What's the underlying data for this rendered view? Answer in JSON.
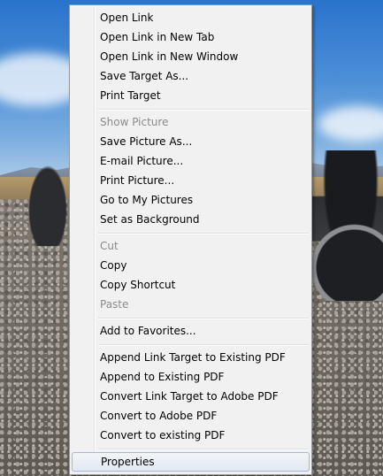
{
  "context_menu": {
    "groups": [
      {
        "items": [
          {
            "label": "Open Link"
          },
          {
            "label": "Open Link in New Tab"
          },
          {
            "label": "Open Link in New Window"
          },
          {
            "label": "Save Target As..."
          },
          {
            "label": "Print Target"
          }
        ]
      },
      {
        "items": [
          {
            "label": "Show Picture",
            "disabled": true
          },
          {
            "label": "Save Picture As..."
          },
          {
            "label": "E-mail Picture..."
          },
          {
            "label": "Print Picture..."
          },
          {
            "label": "Go to My Pictures"
          },
          {
            "label": "Set as Background"
          }
        ]
      },
      {
        "items": [
          {
            "label": "Cut",
            "disabled": true
          },
          {
            "label": "Copy"
          },
          {
            "label": "Copy Shortcut"
          },
          {
            "label": "Paste",
            "disabled": true
          }
        ]
      },
      {
        "items": [
          {
            "label": "Add to Favorites..."
          }
        ]
      },
      {
        "items": [
          {
            "label": "Append Link Target to Existing PDF"
          },
          {
            "label": "Append to Existing PDF"
          },
          {
            "label": "Convert Link Target to Adobe PDF"
          },
          {
            "label": "Convert to Adobe PDF"
          },
          {
            "label": "Convert to existing PDF"
          }
        ]
      },
      {
        "items": [
          {
            "label": "Properties",
            "highlighted": true
          }
        ]
      }
    ]
  },
  "colors": {
    "menu_background": "#f1f1f1",
    "menu_border": "#979797",
    "disabled_text": "#8b8b8b",
    "highlight_border": "#a8b8d0"
  }
}
